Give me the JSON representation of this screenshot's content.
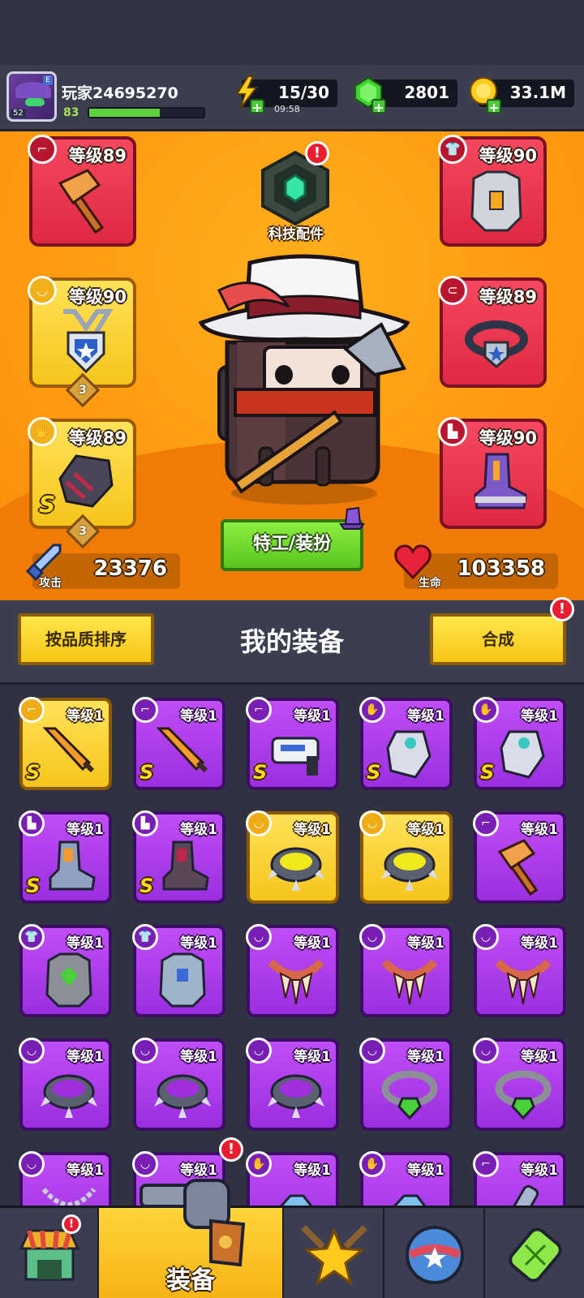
{
  "player": {
    "name": "玩家24695270",
    "level": "83",
    "avatar_level": "52",
    "avatar_tag": "E",
    "xp_fraction": 0.62
  },
  "resources": {
    "energy": {
      "value": "15/30",
      "timer": "09:58"
    },
    "gems": {
      "value": "2801"
    },
    "gold": {
      "value": "33.1M"
    }
  },
  "tech": {
    "label": "科技配件",
    "alert": "!"
  },
  "slots": {
    "weapon": {
      "level": "等级89"
    },
    "armor": {
      "level": "等级90"
    },
    "necklace": {
      "level": "等级90",
      "stars": "3"
    },
    "belt": {
      "level": "等级89"
    },
    "gloves": {
      "level": "等级89",
      "stars": "3",
      "grade": "S"
    },
    "boots": {
      "level": "等级90"
    }
  },
  "costume_button": "特工/装扮",
  "stats": {
    "attack": {
      "label": "攻击",
      "value": "23376"
    },
    "health": {
      "label": "生命",
      "value": "103358"
    }
  },
  "equipment": {
    "sort_button": "按品质排序",
    "title": "我的装备",
    "merge_button": "合成",
    "merge_alert": "!"
  },
  "inventory": {
    "level_label": "等级1",
    "grade": "S"
  },
  "nav": {
    "equip_label": "装备",
    "shop_alert": "!",
    "equip_alert": "!"
  }
}
